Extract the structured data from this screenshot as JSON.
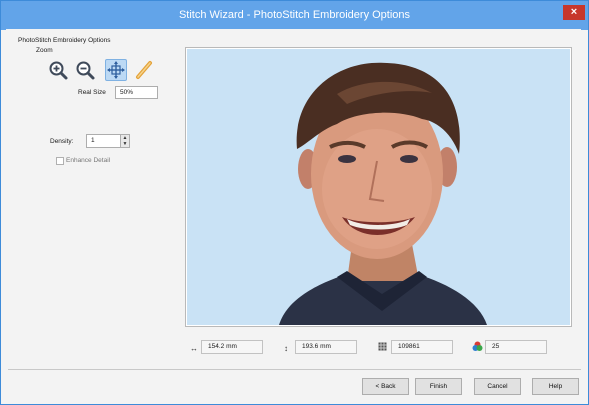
{
  "window": {
    "title": "Stitch Wizard - PhotoStitch Embroidery Options",
    "close_glyph": "×"
  },
  "options": {
    "section_label": "PhotoStitch Embroidery Options",
    "zoom_label": "Zoom",
    "zoom_buttons": [
      "zoom-in-icon",
      "zoom-out-icon",
      "fit-to-window-icon",
      "measure-icon"
    ],
    "real_size_label": "Real Size",
    "real_size_value": "50%",
    "density_label": "Density:",
    "density_value": "1",
    "enhance_label": "Enhance Detail",
    "enhance_checked": false
  },
  "preview": {
    "subject": "embroidery preview of a smiling boy portrait",
    "background_color": "#c9e2f5"
  },
  "stats": {
    "width_icon": "↔",
    "width_value": "154.2 mm",
    "height_icon": "↕",
    "height_value": "193.6 mm",
    "stitches_icon": "stitch-count-icon",
    "stitches_value": "109861",
    "colors_icon": "color-count-icon",
    "colors_value": "25"
  },
  "buttons": {
    "back": "< Back",
    "finish": "Finish",
    "cancel": "Cancel",
    "help": "Help"
  },
  "colors": {
    "titlebar": "#62a4e9",
    "close": "#c7372c",
    "accent": "#3d8bd9"
  }
}
